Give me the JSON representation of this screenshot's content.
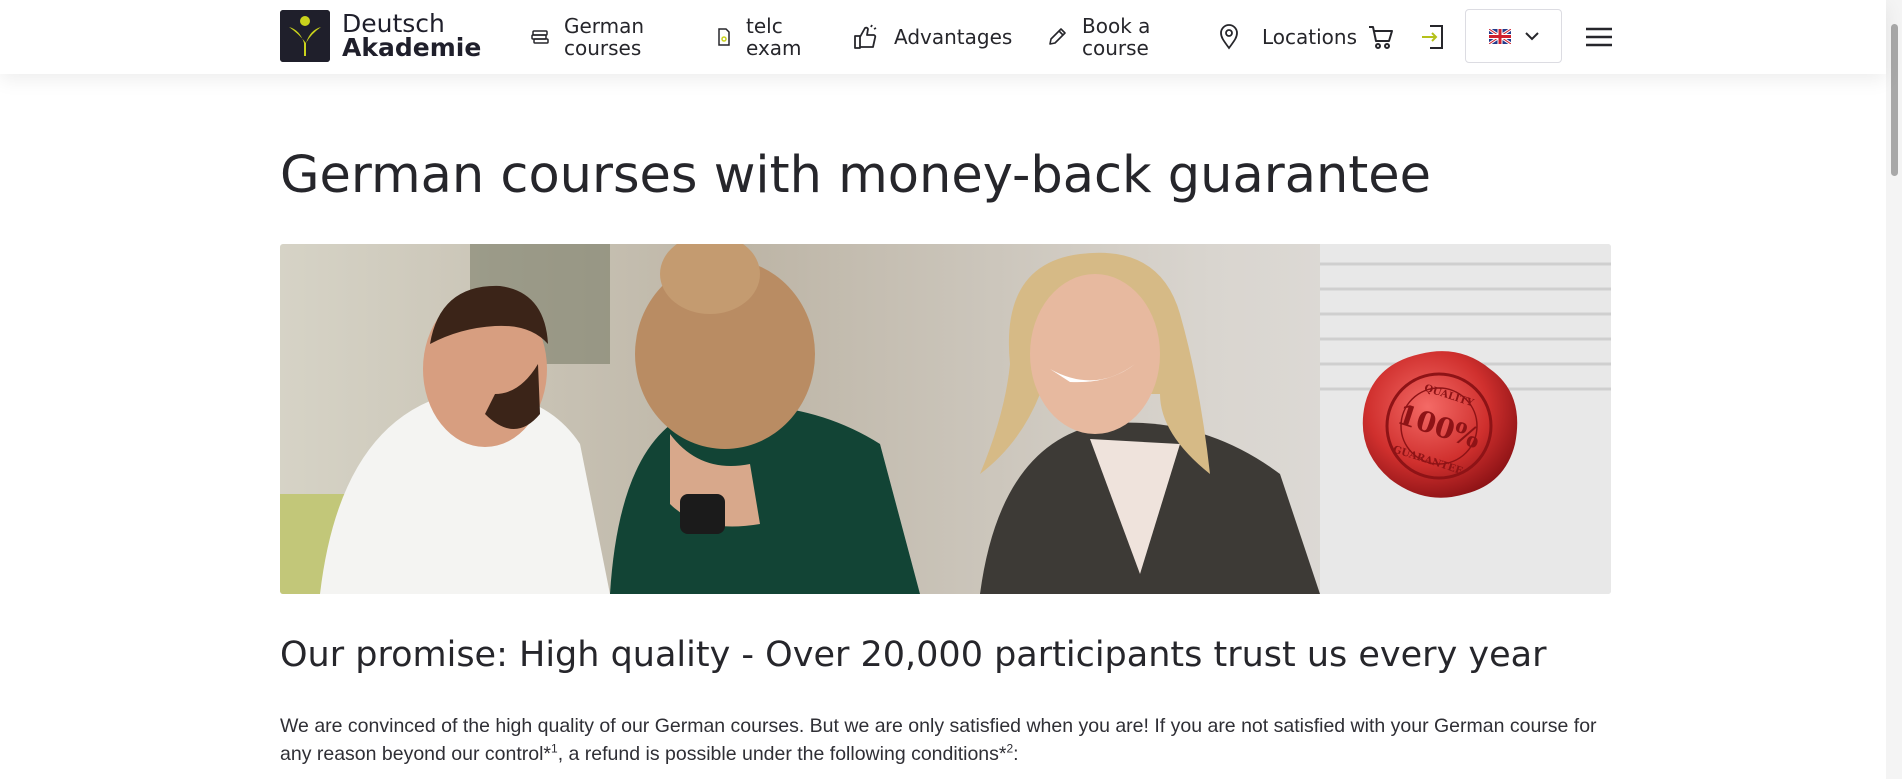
{
  "brand": {
    "line1": "Deutsch",
    "line2": "Akademie"
  },
  "nav": {
    "german_courses": "German\ncourses",
    "telc_exam": "telc\nexam",
    "advantages": "Advantages",
    "book_course": "Book a\ncourse",
    "locations": "Locations"
  },
  "icons": {
    "courses": "courses-icon",
    "telc": "certificate-icon",
    "advantages": "thumbs-up-icon",
    "book": "pencil-icon",
    "location": "map-pin-icon",
    "cart": "cart-icon",
    "login": "login-icon",
    "language": "uk-flag-icon",
    "menu": "hamburger-menu-icon"
  },
  "colors": {
    "brand_dark": "#1f1f2b",
    "brand_accent": "#c9d21c",
    "text": "#26262b",
    "seal_red": "#c9272a"
  },
  "page": {
    "title": "German courses with money-back guarantee",
    "seal": {
      "line1": "QUALITY",
      "line2": "100%",
      "line3": "GUARANTEE"
    },
    "promise_heading": "Our promise: High quality - Over 20,000 participants trust us every year",
    "intro_part1": "We are convinced of the high quality of our German courses. But we are only satisfied when you are! If you are not satisfied with your German course for any reason beyond our control*",
    "intro_sup1": "1",
    "intro_part2": ", a refund is possible under the following conditions*",
    "intro_sup2": "2",
    "intro_part3": ":"
  }
}
